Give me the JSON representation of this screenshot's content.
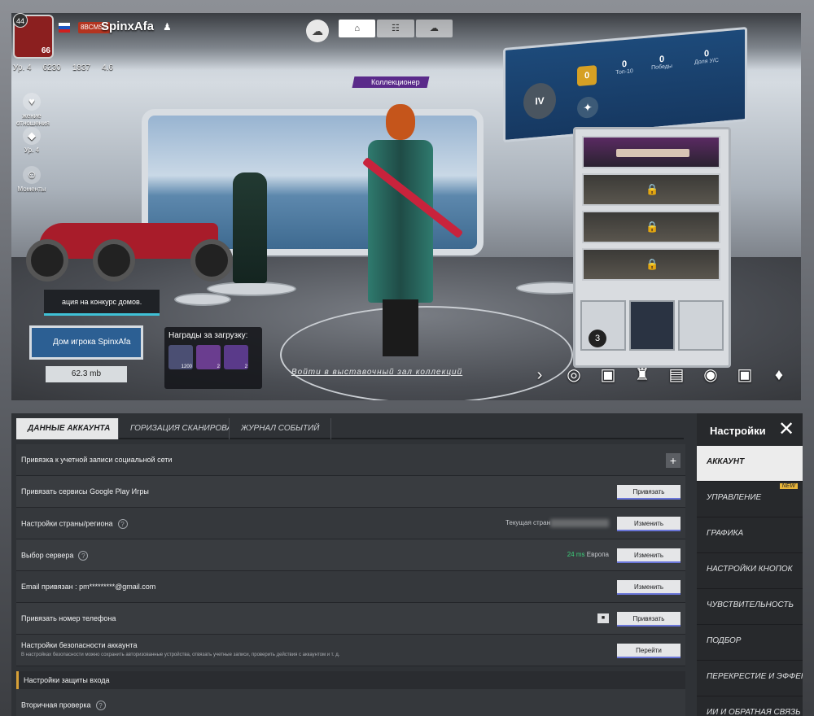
{
  "profile": {
    "level_badge": "44",
    "avatar_level": "66",
    "name": "SpinxAfa",
    "clan_tag": "8BCMSK",
    "stats": [
      "Ур. 4",
      "6230",
      "1837",
      "4.6"
    ]
  },
  "side_icons": [
    {
      "label": "жение отношения",
      "icon": "♥"
    },
    {
      "label": "Ур. 4",
      "icon": "◆"
    },
    {
      "label": "Моменты",
      "icon": "☺"
    }
  ],
  "collector_tag": "Коллекционер",
  "board": {
    "stats": [
      {
        "value": "0",
        "label": "Топ-10"
      },
      {
        "value": "0",
        "label": "Победы"
      },
      {
        "value": "0",
        "label": "Доля У/С"
      }
    ],
    "tier": "IV",
    "rank_value": "0"
  },
  "contest_button": "ация на конкурс домов.",
  "home_button": "Дом игрока SpinxAfa",
  "home_size": "62.3 mb",
  "rewards": {
    "title": "Награды за загрузку:",
    "items": [
      {
        "qty": "1200"
      },
      {
        "qty": "2"
      },
      {
        "qty": "2"
      }
    ]
  },
  "case_badge": "3",
  "gallery_link": "Войти в выставочный зал коллекций",
  "settings": {
    "tabs": [
      "Данные аккаунта",
      "горизация сканированием",
      "Журнал событий"
    ],
    "rows": [
      {
        "label": "Привязка к учетной записи социальной сети",
        "control": "+"
      },
      {
        "label": "Привязать сервисы Google Play Игры",
        "button": "Привязать"
      },
      {
        "label": "Настройки страны/региона",
        "help": "?",
        "info": "Текущая стран",
        "button": "Изменить"
      },
      {
        "label": "Выбор сервера",
        "help": "?",
        "ping": "24 ms",
        "region": "Европа",
        "button": "Изменить"
      },
      {
        "label": "Email привязан : pm*********@gmail.com",
        "button": "Изменить"
      },
      {
        "label": "Привязать номер телефона",
        "button": "Привязать"
      },
      {
        "label": "Настройки безопасности аккаунта",
        "sub": "В настройках безопасности можно сохранить авторизованные устройства, отвязать учетные записи, проверить действия с аккаунтом и т. д.",
        "button": "Перейти"
      }
    ],
    "section_title": "Настройки защиты входа",
    "section_row": {
      "label": "Вторичная проверка",
      "help": "?"
    },
    "sidebar": {
      "title": "Настройки",
      "close": "✕",
      "new_badge": "NEW",
      "items": [
        "Аккаунт",
        "Управление",
        "Графика",
        "Настройки кнопок",
        "Чувствительность",
        "Подбор",
        "Перекрестие и эффекты",
        "Ии и обратная связь"
      ]
    }
  }
}
